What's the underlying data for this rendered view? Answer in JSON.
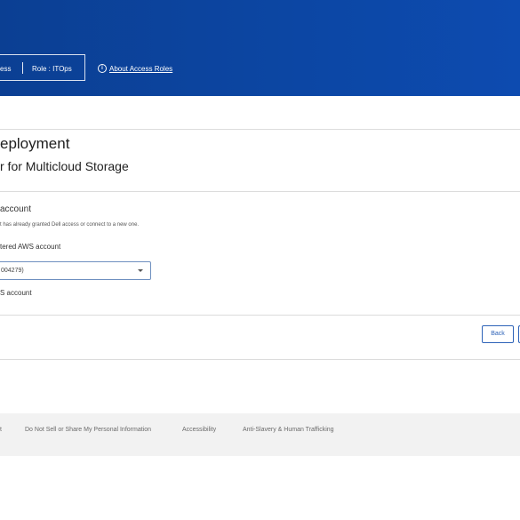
{
  "header": {
    "access_text": "ess",
    "role_text": "Role : ITOps",
    "about_link": "About Access Roles",
    "info_icon_glyph": "i",
    "background_color": "#0c46a3"
  },
  "main": {
    "title": "eployment",
    "subtitle": "r for Multicloud Storage"
  },
  "account_section": {
    "title": "account",
    "description": "t has already granted Dell access or connect to a new one.",
    "option_registered_label": "tered AWS account",
    "selected_account": "004279)",
    "option_new_label": "S account"
  },
  "actions": {
    "back_label": "Back"
  },
  "footer": {
    "links": [
      "t",
      "Do Not Sell or Share My Personal Information",
      "Accessibility",
      "Anti-Slavery & Human Trafficking"
    ]
  }
}
